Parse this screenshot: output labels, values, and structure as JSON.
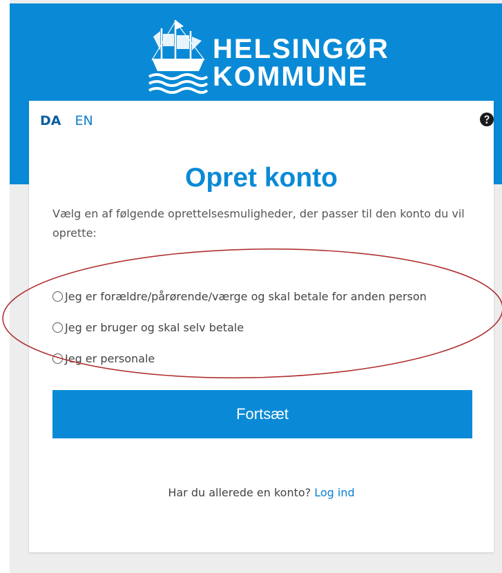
{
  "brand": {
    "name_line1": "HELSINGØR",
    "name_line2": "KOMMUNE",
    "color": "#0a8ad6"
  },
  "language": {
    "options": [
      "DA",
      "EN"
    ],
    "selected": "DA"
  },
  "help": {
    "icon": "help-circle-icon"
  },
  "form": {
    "title": "Opret konto",
    "intro": "Vælg en af følgende oprettelsesmuligheder, der passer til den konto du vil oprette:",
    "options": [
      "Jeg er forældre/pårørende/værge og skal betale for anden person",
      "Jeg er bruger og skal selv betale",
      "Jeg er personale"
    ],
    "continue_label": "Fortsæt"
  },
  "login": {
    "prompt": "Har du allerede en konto?",
    "link_label": "Log ind"
  },
  "annotation": {
    "color": "#b03030"
  }
}
